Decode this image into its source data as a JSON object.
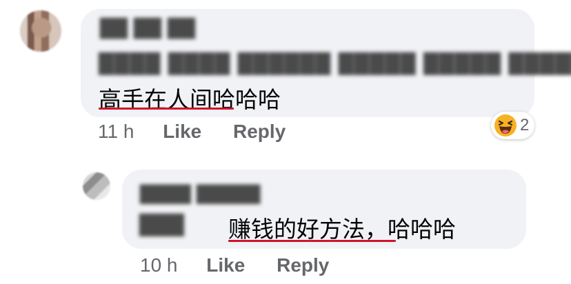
{
  "comment": {
    "author": "██ ██ ██",
    "tags": "████ ████ ██████ █████ █████ █████",
    "text": "高手在人间哈哈哈",
    "time": "11 h",
    "like_label": "Like",
    "reply_label": "Reply",
    "reaction_icon": "haha-emoji-icon",
    "reaction_count": "2"
  },
  "reply": {
    "author": "████ █████",
    "tag": "███",
    "text": "赚钱的好方法，哈哈哈",
    "time": "10 h",
    "like_label": "Like",
    "reply_label": "Reply"
  },
  "colors": {
    "bubble": "#f0f2f5",
    "meta_text": "#65676b",
    "underline": "#d0142a",
    "reaction_face": "#f7b125"
  }
}
